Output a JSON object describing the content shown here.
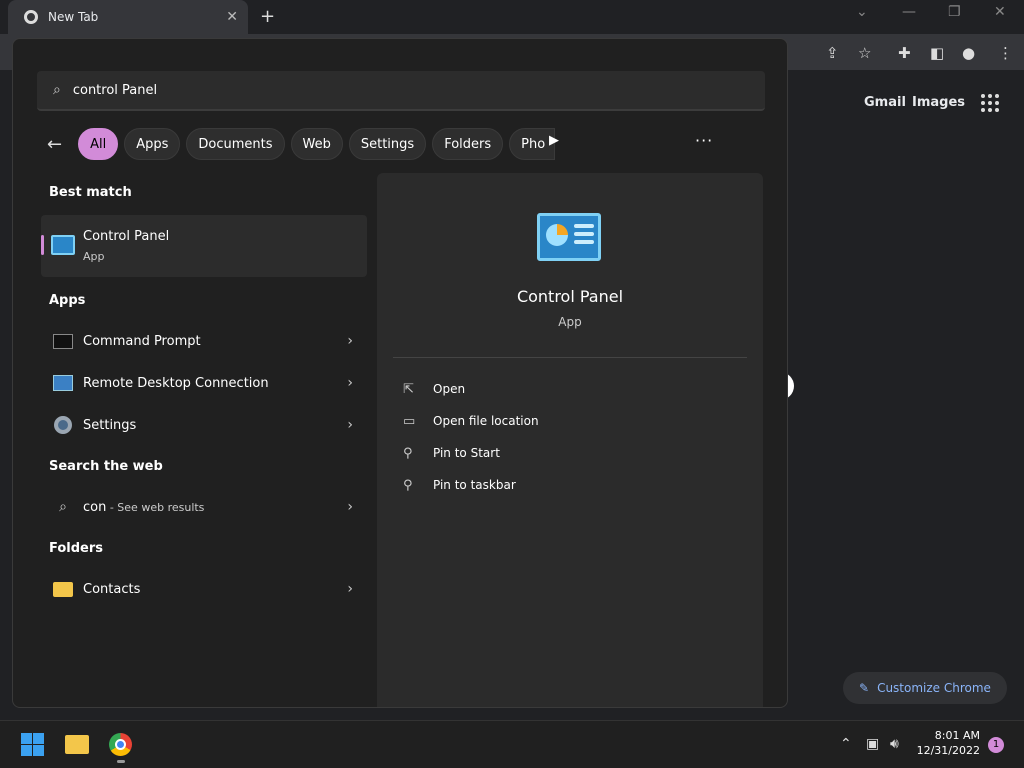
{
  "browser": {
    "tab_title": "New Tab",
    "tab_close": "✕",
    "new_tab": "+",
    "links": {
      "gmail": "Gmail",
      "images": "Images"
    },
    "customize_label": "Customize Chrome"
  },
  "search": {
    "query": "control Panel",
    "filters": [
      {
        "label": "All",
        "active": true
      },
      {
        "label": "Apps"
      },
      {
        "label": "Documents"
      },
      {
        "label": "Web"
      },
      {
        "label": "Settings"
      },
      {
        "label": "Folders"
      },
      {
        "label": "Pho"
      }
    ],
    "more": "···"
  },
  "results": {
    "best_match_heading": "Best match",
    "best_match": {
      "name": "Control Panel",
      "type": "App"
    },
    "apps_heading": "Apps",
    "apps": [
      "Command Prompt",
      "Remote Desktop Connection",
      "Settings"
    ],
    "web_heading": "Search the web",
    "web": {
      "term": "con",
      "suffix": " - See web results"
    },
    "folders_heading": "Folders",
    "folders": [
      "Contacts"
    ]
  },
  "detail": {
    "name": "Control Panel",
    "type": "App",
    "actions": [
      "Open",
      "Open file location",
      "Pin to Start",
      "Pin to taskbar"
    ]
  },
  "taskbar": {
    "time": "8:01 AM",
    "date": "12/31/2022",
    "notifications": "1"
  },
  "colors": {
    "accent": "#d28bd8",
    "flyout_bg": "#202020",
    "pane_bg": "#2b2b2b"
  }
}
